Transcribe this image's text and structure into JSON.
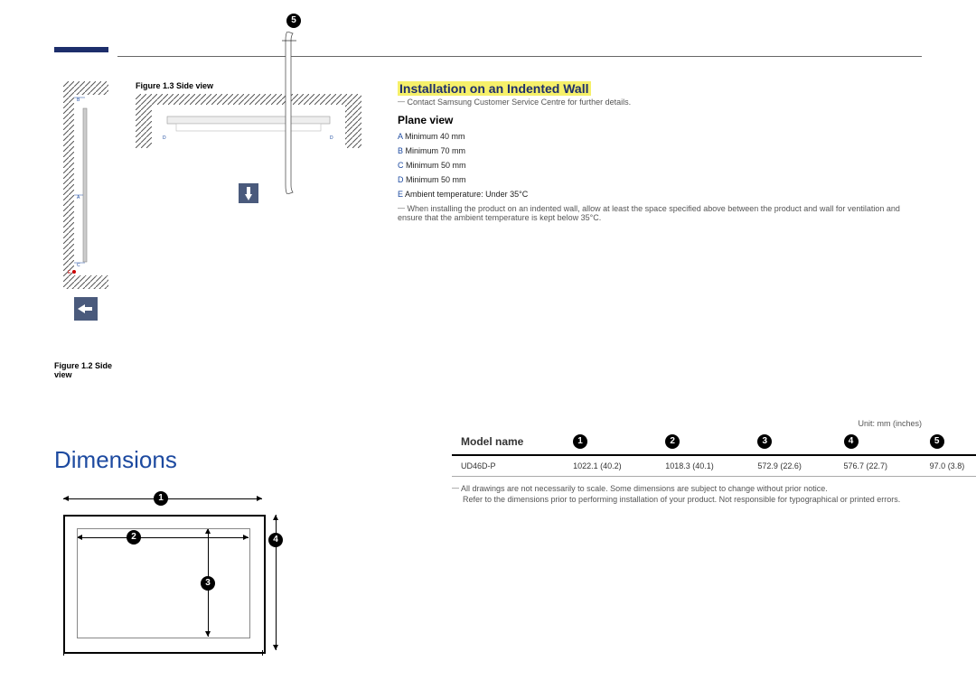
{
  "figures": {
    "f13": "Figure 1.3 Side view",
    "f12": "Figure 1.2 Side view"
  },
  "install": {
    "title": "Installation on an Indented Wall",
    "note1": "Contact Samsung Customer Service Centre for further details.",
    "plane_title": "Plane view",
    "specs": {
      "A": {
        "k": "A",
        "v": "Minimum 40 mm"
      },
      "B": {
        "k": "B",
        "v": "Minimum 70 mm"
      },
      "C": {
        "k": "C",
        "v": "Minimum 50 mm"
      },
      "D": {
        "k": "D",
        "v": "Minimum 50 mm"
      },
      "E": {
        "k": "E",
        "v": "Ambient temperature: Under 35°C"
      }
    },
    "note2": "When installing the product on an indented wall, allow at least the space specified above between the product and wall for ventilation and ensure that the ambient temperature is kept below 35°C."
  },
  "dims": {
    "title": "Dimensions",
    "unit": "Unit: mm (inches)",
    "model_label": "Model name",
    "row": {
      "model": "UD46D-P",
      "c1": "1022.1 (40.2)",
      "c2": "1018.3 (40.1)",
      "c3": "572.9 (22.6)",
      "c4": "576.7 (22.7)",
      "c5": "97.0 (3.8)"
    },
    "foot1": "All drawings are not necessarily to scale. Some dimensions are subject to change without prior notice.",
    "foot2": "Refer to the dimensions prior to performing installation of your product. Not responsible for typographical or printed errors."
  },
  "bullets": {
    "b1": "1",
    "b2": "2",
    "b3": "3",
    "b4": "4",
    "b5": "5"
  },
  "labels": {
    "A": "A",
    "B": "B",
    "C": "C",
    "D": "D",
    "E": "E"
  }
}
